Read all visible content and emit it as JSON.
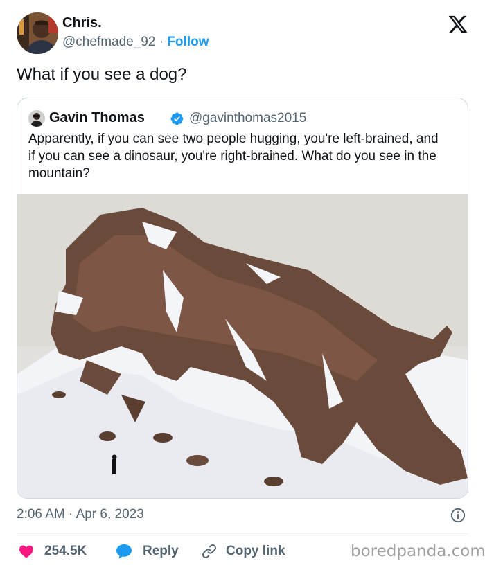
{
  "author": {
    "name": "Chris.",
    "handle": "@chefmade_92",
    "separator": "·",
    "follow_label": "Follow",
    "avatar_icon": "avatar-photo"
  },
  "platform_icon": "x-logo-icon",
  "tweet_text": "What if you see a dog?",
  "quoted": {
    "name": "Gavin Thomas",
    "verified_icon": "verified-badge-icon",
    "handle": "@gavinthomas2015",
    "text": "Apparently, if you can see two people hugging, you're left-brained, and if you can see a dinosaur, you're right-brained. What do you see in the mountain?",
    "image_icon": "snowy-mountain-photo"
  },
  "timestamp": {
    "time": "2:06 AM",
    "separator": "·",
    "date": "Apr 6, 2023"
  },
  "actions": {
    "likes": "254.5K",
    "reply_label": "Reply",
    "copy_label": "Copy link"
  },
  "watermark": "boredpanda.com",
  "colors": {
    "accent": "#1d9bf0",
    "heart": "#f91880",
    "muted": "#536471",
    "text": "#0f1419",
    "border": "#cfd9de"
  }
}
